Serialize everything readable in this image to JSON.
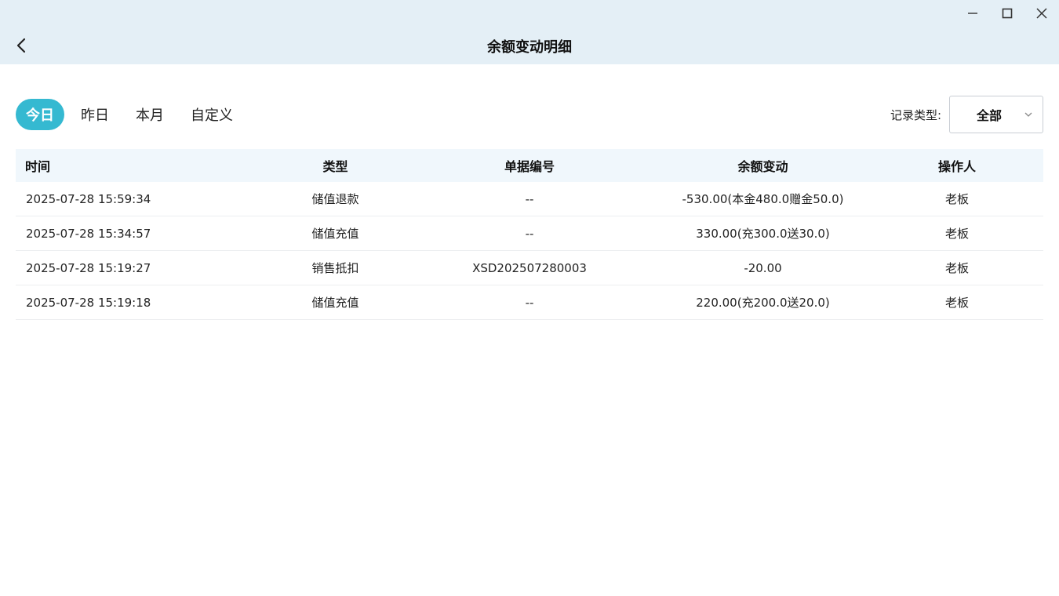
{
  "window": {
    "title": "余额变动明细",
    "controls": [
      "minimize-icon",
      "maximize-icon",
      "close-icon"
    ]
  },
  "filters": {
    "tabs": [
      {
        "label": "今日",
        "active": true
      },
      {
        "label": "昨日",
        "active": false
      },
      {
        "label": "本月",
        "active": false
      },
      {
        "label": "自定义",
        "active": false
      }
    ],
    "record_type_label": "记录类型:",
    "record_type_value": "全部"
  },
  "table": {
    "headers": {
      "time": "时间",
      "type": "类型",
      "doc_no": "单据编号",
      "balance_change": "余额变动",
      "operator": "操作人"
    },
    "rows": [
      {
        "time": "2025-07-28 15:59:34",
        "type": "储值退款",
        "doc_no": "--",
        "balance_change": "-530.00(本金480.0赠金50.0)",
        "operator": "老板"
      },
      {
        "time": "2025-07-28 15:34:57",
        "type": "储值充值",
        "doc_no": "--",
        "balance_change": "330.00(充300.0送30.0)",
        "operator": "老板"
      },
      {
        "time": "2025-07-28 15:19:27",
        "type": "销售抵扣",
        "doc_no": "XSD202507280003",
        "balance_change": "-20.00",
        "operator": "老板"
      },
      {
        "time": "2025-07-28 15:19:18",
        "type": "储值充值",
        "doc_no": "--",
        "balance_change": "220.00(充200.0送20.0)",
        "operator": "老板"
      }
    ]
  },
  "colors": {
    "titlebar_bg": "#e4eff6",
    "accent": "#35b9d1",
    "table_header_bg": "#f0f7fc"
  }
}
